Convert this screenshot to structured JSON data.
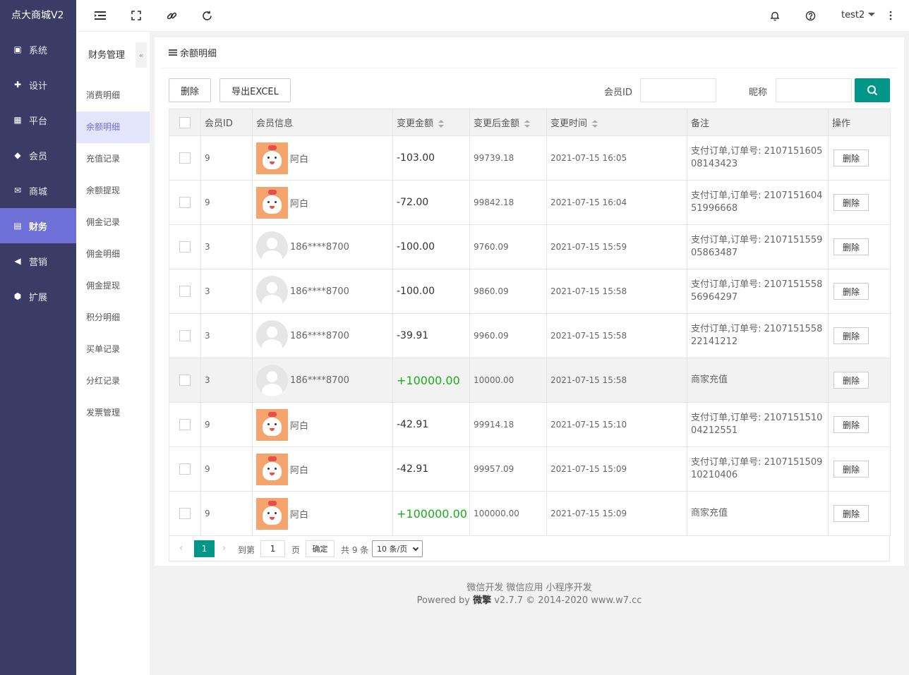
{
  "brand": "点大商城V2",
  "sidebar": {
    "items": [
      {
        "label": "系统",
        "icon": "monitor-icon",
        "glyph": "▣"
      },
      {
        "label": "设计",
        "icon": "puzzle-icon",
        "glyph": "✚"
      },
      {
        "label": "平台",
        "icon": "grid-icon",
        "glyph": "▦"
      },
      {
        "label": "会员",
        "icon": "diamond-icon",
        "glyph": "◆"
      },
      {
        "label": "商城",
        "icon": "mail-icon",
        "glyph": "✉"
      },
      {
        "label": "财务",
        "icon": "wallet-icon",
        "glyph": "▤",
        "active": true
      },
      {
        "label": "营销",
        "icon": "megaphone-icon",
        "glyph": "◀"
      },
      {
        "label": "扩展",
        "icon": "cube-icon",
        "glyph": "⬢"
      }
    ]
  },
  "topbar": {
    "user": "test2"
  },
  "subnav": {
    "title": "财务管理",
    "collapse_glyph": "«",
    "items": [
      "消费明细",
      "余额明细",
      "充值记录",
      "余额提现",
      "佣金记录",
      "佣金明细",
      "佣金提现",
      "积分明细",
      "买单记录",
      "分红记录",
      "发票管理"
    ],
    "active_index": 1
  },
  "card": {
    "title": "余额明细"
  },
  "toolbar": {
    "delete_label": "删除",
    "export_label": "导出EXCEL",
    "member_id_label": "会员ID",
    "nickname_label": "昵称",
    "member_id_value": "",
    "nickname_value": ""
  },
  "table": {
    "headers": {
      "member_id": "会员ID",
      "member_info": "会员信息",
      "change_amount": "变更金额",
      "after_amount": "变更后金额",
      "change_time": "变更时间",
      "remark": "备注",
      "actions": "操作"
    },
    "delete_label": "删除",
    "rows": [
      {
        "member_id": "9",
        "avatar": "dog",
        "name": "阿白",
        "amount": "-103.00",
        "after": "99739.18",
        "time": "2021-07-15 16:05",
        "remark": "支付订单,订单号: 210715160508143423"
      },
      {
        "member_id": "9",
        "avatar": "dog",
        "name": "阿白",
        "amount": "-72.00",
        "after": "99842.18",
        "time": "2021-07-15 16:04",
        "remark": "支付订单,订单号: 210715160451996668"
      },
      {
        "member_id": "3",
        "avatar": "default",
        "name": "186****8700",
        "amount": "-100.00",
        "after": "9760.09",
        "time": "2021-07-15 15:59",
        "remark": "支付订单,订单号: 210715155905863487"
      },
      {
        "member_id": "3",
        "avatar": "default",
        "name": "186****8700",
        "amount": "-100.00",
        "after": "9860.09",
        "time": "2021-07-15 15:58",
        "remark": "支付订单,订单号: 210715155856964297"
      },
      {
        "member_id": "3",
        "avatar": "default",
        "name": "186****8700",
        "amount": "-39.91",
        "after": "9960.09",
        "time": "2021-07-15 15:58",
        "remark": "支付订单,订单号: 210715155822141212"
      },
      {
        "member_id": "3",
        "avatar": "default",
        "name": "186****8700",
        "amount": "+10000.00",
        "after": "10000.00",
        "time": "2021-07-15 15:58",
        "remark": "商家充值",
        "highlight": true
      },
      {
        "member_id": "9",
        "avatar": "dog",
        "name": "阿白",
        "amount": "-42.91",
        "after": "99914.18",
        "time": "2021-07-15 15:10",
        "remark": "支付订单,订单号: 210715151004212551"
      },
      {
        "member_id": "9",
        "avatar": "dog",
        "name": "阿白",
        "amount": "-42.91",
        "after": "99957.09",
        "time": "2021-07-15 15:09",
        "remark": "支付订单,订单号: 210715150910210406"
      },
      {
        "member_id": "9",
        "avatar": "dog",
        "name": "阿白",
        "amount": "+100000.00",
        "after": "100000.00",
        "time": "2021-07-15 15:09",
        "remark": "商家充值"
      }
    ]
  },
  "pagination": {
    "current": "1",
    "goto_label": "到第",
    "goto_value": "1",
    "page_unit": "页",
    "confirm_label": "确定",
    "total_label": "共 9 条",
    "page_size": "10 条/页"
  },
  "footer": {
    "links": "微信开发 微信应用 小程序开发",
    "powered_prefix": "Powered by",
    "powered_brand": "微擎",
    "powered_suffix": "v2.7.7 © 2014-2020 www.w7.cc"
  },
  "colors": {
    "sidebar_bg": "#3a3c65",
    "sidebar_active": "#6f6fd8",
    "accent_green": "#009688",
    "positive_amount": "#1aad19"
  }
}
